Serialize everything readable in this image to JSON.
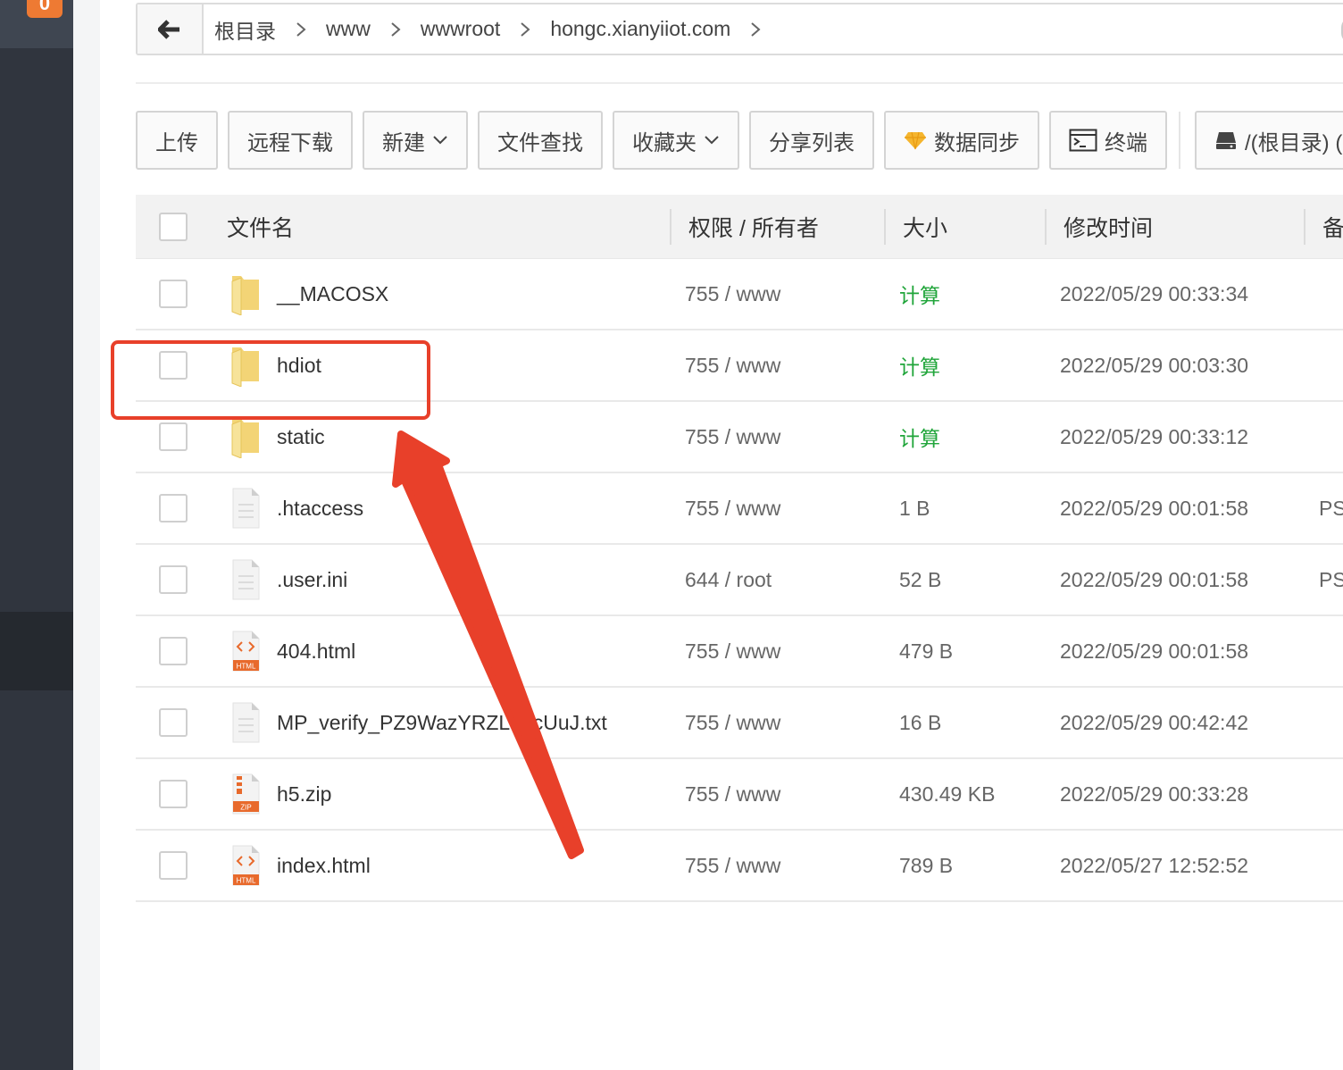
{
  "sidebar": {
    "badge": "0"
  },
  "breadcrumb": {
    "items": [
      "根目录",
      "www",
      "wwwroot",
      "hongc.xianyiiot.com"
    ]
  },
  "toolbar": {
    "upload": "上传",
    "remote_download": "远程下载",
    "new": "新建",
    "file_search": "文件查找",
    "favorites": "收藏夹",
    "share_list": "分享列表",
    "data_sync": "数据同步",
    "terminal": "终端",
    "disk": "/(根目录) ("
  },
  "table": {
    "headers": {
      "name": "文件名",
      "perm_owner": "权限 / 所有者",
      "size": "大小",
      "mtime": "修改时间",
      "note": "备"
    },
    "rows": [
      {
        "name": "__MACOSX",
        "icon": "folder-icon",
        "perm": "755 / www",
        "size": "计算",
        "mtime": "2022/05/29 00:33:34",
        "note": ""
      },
      {
        "name": "hdiot",
        "icon": "folder-icon",
        "perm": "755 / www",
        "size": "计算",
        "mtime": "2022/05/29 00:03:30",
        "note": ""
      },
      {
        "name": "static",
        "icon": "folder-icon",
        "perm": "755 / www",
        "size": "计算",
        "mtime": "2022/05/29 00:33:12",
        "note": ""
      },
      {
        "name": ".htaccess",
        "icon": "text-file-icon",
        "perm": "755 / www",
        "size": "1 B",
        "mtime": "2022/05/29 00:01:58",
        "note": "PS"
      },
      {
        "name": ".user.ini",
        "icon": "text-file-icon",
        "perm": "644 / root",
        "size": "52 B",
        "mtime": "2022/05/29 00:01:58",
        "note": "PS"
      },
      {
        "name": "404.html",
        "icon": "html-file-icon",
        "perm": "755 / www",
        "size": "479 B",
        "mtime": "2022/05/29 00:01:58",
        "note": ""
      },
      {
        "name": "MP_verify_PZ9WazYRZL62cUuJ.txt",
        "icon": "text-file-icon",
        "perm": "755 / www",
        "size": "16 B",
        "mtime": "2022/05/29 00:42:42",
        "note": ""
      },
      {
        "name": "h5.zip",
        "icon": "zip-file-icon",
        "perm": "755 / www",
        "size": "430.49 KB",
        "mtime": "2022/05/29 00:33:28",
        "note": ""
      },
      {
        "name": "index.html",
        "icon": "html-file-icon",
        "perm": "755 / www",
        "size": "789 B",
        "mtime": "2022/05/27 12:52:52",
        "note": ""
      }
    ]
  },
  "icon_labels": {
    "html": "HTML",
    "zip": "ZIP"
  },
  "colors": {
    "accent_green": "#20a53a",
    "annotation_red": "#e8402a",
    "sidebar_dark": "#30353e",
    "badge_orange": "#ee7a33"
  }
}
